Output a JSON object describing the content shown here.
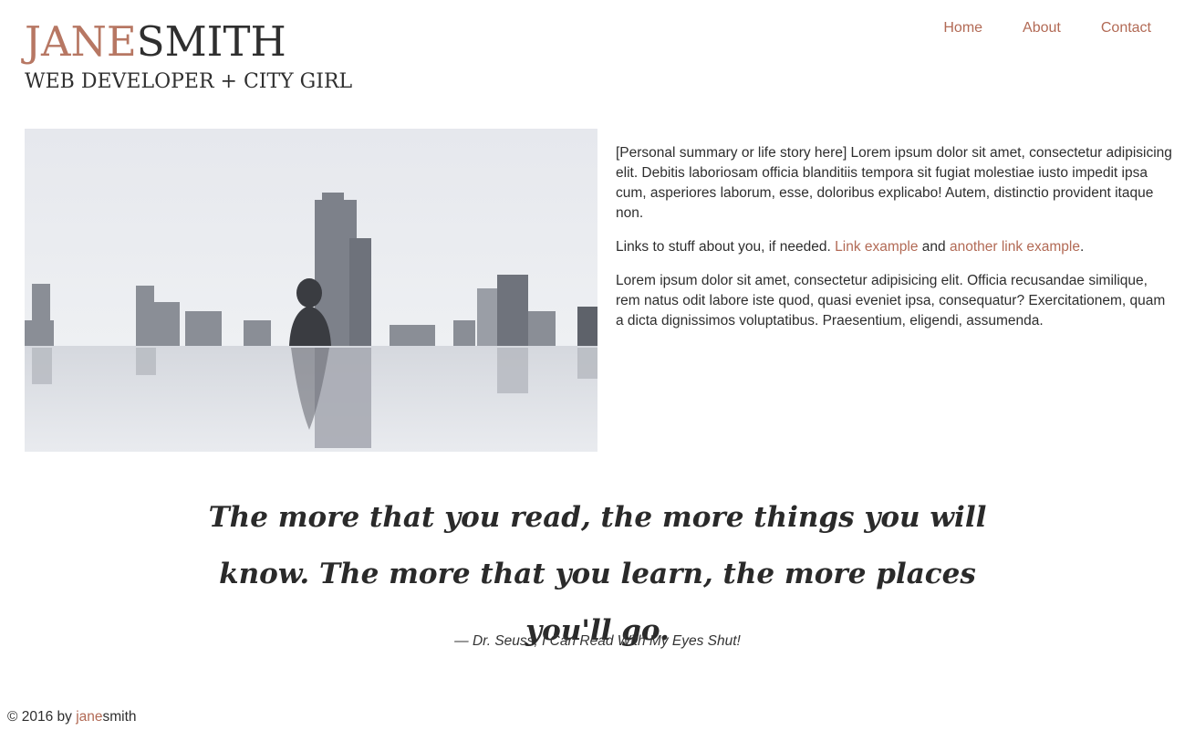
{
  "brand": {
    "first": "JANE",
    "last": "SMITH",
    "tagline": "WEB DEVELOPER + CITY GIRL"
  },
  "nav": {
    "items": [
      {
        "label": "Home"
      },
      {
        "label": "About"
      },
      {
        "label": "Contact"
      }
    ]
  },
  "bio": {
    "p1": "[Personal summary or life story here] Lorem ipsum dolor sit amet, consectetur adipisicing elit. Debitis laboriosam officia blanditiis tempora sit fugiat molestiae iusto impedit ipsa cum, asperiores laborum, esse, doloribus explicabo! Autem, distinctio provident itaque non.",
    "p2_prefix": "Links to stuff about you, if needed. ",
    "link1": "Link example",
    "p2_mid": " and ",
    "link2": "another link example",
    "p2_suffix": ".",
    "p3": "Lorem ipsum dolor sit amet, consectetur adipisicing elit. Officia recusandae similique, rem natus odit labore iste quod, quasi eveniet ipsa, consequatur? Exercitationem, quam a dicta dignissimos voluptatibus. Praesentium, eligendi, assumenda."
  },
  "quote": {
    "text": "The more that you read, the more things you will know. The more that you learn, the more places you'll go.",
    "cite": "— Dr. Seuss, I Can Read With My Eyes Shut!"
  },
  "footer": {
    "prefix": "© 2016 by ",
    "name_first": "jane",
    "name_last": "smith"
  },
  "colors": {
    "accent": "#b26a55",
    "text": "#2f2f2f",
    "background": "#ffffff"
  }
}
